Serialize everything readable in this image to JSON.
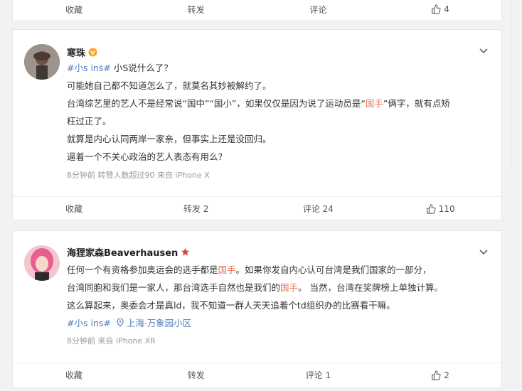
{
  "top_actions": {
    "favorite": "收藏",
    "repost": "转发",
    "comment": "评论",
    "like_count": "4"
  },
  "post1": {
    "username": "寒珠",
    "badge": "V",
    "line1_tag": "#小s ins#",
    "line1_text": "小S说什么了？",
    "line2": "可能她自己都不知道怎么了，就莫名其妙被解约了。",
    "line3_a": "台湾综艺里的艺人不是经常说“国中”“国小”，如果仅仅是因为说了运动员是“",
    "line3_highlight": "国手",
    "line3_b": "”俩字，就有点矫",
    "line4": "枉过正了。",
    "line5": "就算是内心认同两岸一家亲，但事实上还是没回归。",
    "line6": "逼着一个不关心政治的艺人表态有用么？",
    "meta": "8分钟前 转赞人数超过90  来自 iPhone X",
    "actions": {
      "favorite": "收藏",
      "repost": "转发 2",
      "comment": "评论 24",
      "like_count": "110"
    }
  },
  "post2": {
    "username": "海狸家森Beaverhausen",
    "line1_a": "任何一个有资格参加奥运会的选手都是",
    "line1_highlight": "国手",
    "line1_b": "。如果你发自内心认可台湾是我们国家的一部分，",
    "line2_a": "台湾同胞和我们是一家人，那台湾选手自然也是我们的",
    "line2_highlight": "国手",
    "line2_b": "。 当然，台湾在奖牌榜上单独计算。",
    "line3": "这么算起来，奥委会才是真ld，我不知道一群人天天追着个td组织办的比赛看干嘛。",
    "tag": "#小s ins#",
    "location": "上海·万象园小区",
    "meta": "8分钟前  来自 iPhone XR",
    "actions": {
      "favorite": "收藏",
      "repost": "转发",
      "comment": "评论 1",
      "like_count": "2"
    }
  },
  "colors": {
    "link": "#5480b9",
    "highlight": "#eb7350",
    "badge": "#f5a623",
    "star": "#e5423a"
  }
}
